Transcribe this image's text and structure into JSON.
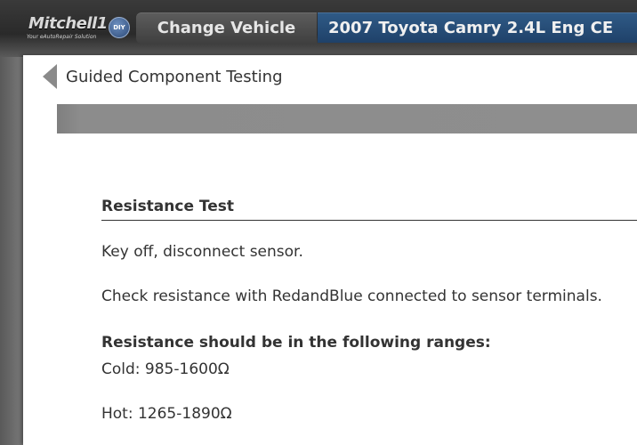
{
  "header": {
    "logo_text": "Mitchell1",
    "logo_tagline": "Your eAutoRepair Solution",
    "logo_badge": "DIY",
    "change_vehicle_label": "Change Vehicle",
    "vehicle_name": "2007 Toyota Camry 2.4L Eng CE"
  },
  "page": {
    "title": "Guided Component Testing"
  },
  "content": {
    "section_title": "Resistance Test",
    "step1": "Key off, disconnect sensor.",
    "step2": "Check resistance with RedandBlue connected to sensor terminals.",
    "ranges_heading": "Resistance should be in the following ranges:",
    "cold": "Cold: 985-1600Ω",
    "hot": "Hot: 1265-1890Ω"
  },
  "colors": {
    "vehicle_bar": "#2a4f7a",
    "header_bg": "#2f2f2f",
    "panel_bg": "#ffffff"
  }
}
